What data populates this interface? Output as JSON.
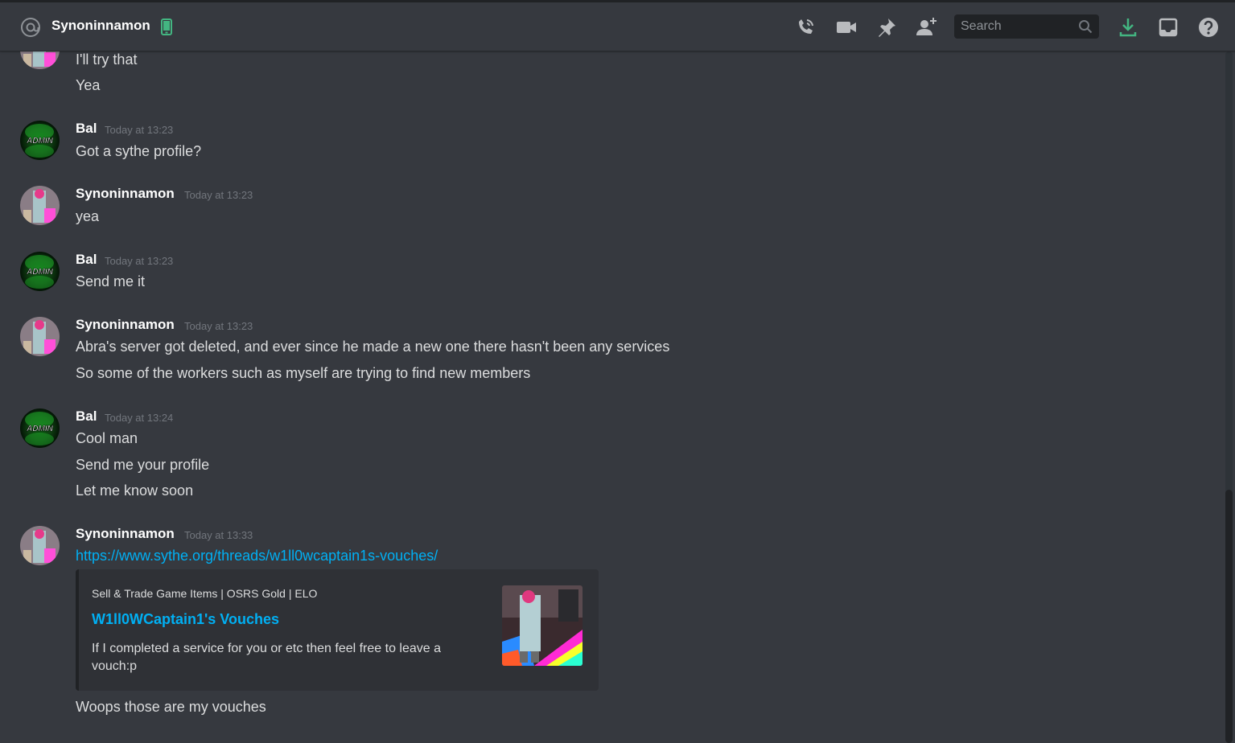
{
  "header": {
    "dm_name": "Synoninnamon",
    "search_placeholder": "Search",
    "icons": [
      "at-icon",
      "mobile-icon",
      "call-icon",
      "video-icon",
      "pin-icon",
      "add-friend-icon",
      "search-icon",
      "download-icon",
      "inbox-icon",
      "help-icon"
    ]
  },
  "messages": [
    {
      "continued_lines": [
        "I'll try that",
        "Yea"
      ]
    },
    {
      "author": "Bal",
      "timestamp": "Today at 13:23",
      "lines": [
        "Got a sythe profile?"
      ],
      "avatar_text": "ADMIN"
    },
    {
      "author": "Synoninnamon",
      "timestamp": "Today at 13:23",
      "lines": [
        "yea"
      ]
    },
    {
      "author": "Bal",
      "timestamp": "Today at 13:23",
      "lines": [
        "Send me it"
      ],
      "avatar_text": "ADMIN"
    },
    {
      "author": "Synoninnamon",
      "timestamp": "Today at 13:23",
      "lines": [
        "Abra's server got deleted, and ever since he made a new one there hasn't been any services",
        "So some of the workers such as myself are trying to find new members"
      ]
    },
    {
      "author": "Bal",
      "timestamp": "Today at 13:24",
      "lines": [
        "Cool man",
        "Send me your profile",
        "Let me know soon"
      ],
      "avatar_text": "ADMIN"
    },
    {
      "author": "Synoninnamon",
      "timestamp": "Today at 13:33",
      "link": "https://www.sythe.org/threads/w1ll0wcaptain1s-vouches/",
      "embed": {
        "provider": "Sell & Trade Game Items | OSRS Gold | ELO",
        "title": "W1ll0WCaptain1's Vouches",
        "description": "If I completed a service for you or etc then feel free to leave a vouch:p"
      },
      "after_embed": "Woops those are my vouches"
    }
  ],
  "colors": {
    "background": "#36393f",
    "header_text": "#ffffff",
    "link": "#00b0f4",
    "timestamp": "#72767d",
    "online_mobile": "#43b581",
    "download": "#43b581"
  }
}
